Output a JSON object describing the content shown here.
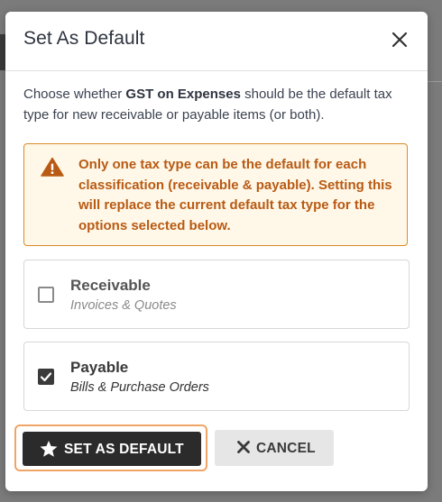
{
  "modal": {
    "title": "Set As Default",
    "close_icon": "close-icon"
  },
  "intro": {
    "prefix": "Choose whether ",
    "item_name": "GST on Expenses",
    "suffix": " should be the default tax type for new receivable or payable items (or both)."
  },
  "warning": {
    "icon": "warning-triangle-icon",
    "text": "Only one tax type can be the default for each classification (receivable & payable). Setting this will replace the current default tax type for the options selected below."
  },
  "options": [
    {
      "label": "Receivable",
      "sublabel": "Invoices & Quotes",
      "checked": false
    },
    {
      "label": "Payable",
      "sublabel": "Bills & Purchase Orders",
      "checked": true
    }
  ],
  "footer": {
    "primary_label": "SET AS DEFAULT",
    "primary_icon": "star-icon",
    "cancel_label": "CANCEL",
    "cancel_icon": "close-icon"
  },
  "colors": {
    "warning_text": "#b85a14",
    "warning_bg": "#fff8e8",
    "warning_border": "#d98a2b",
    "primary_bg": "#2b2b2b",
    "focus_ring": "#f0a466"
  }
}
